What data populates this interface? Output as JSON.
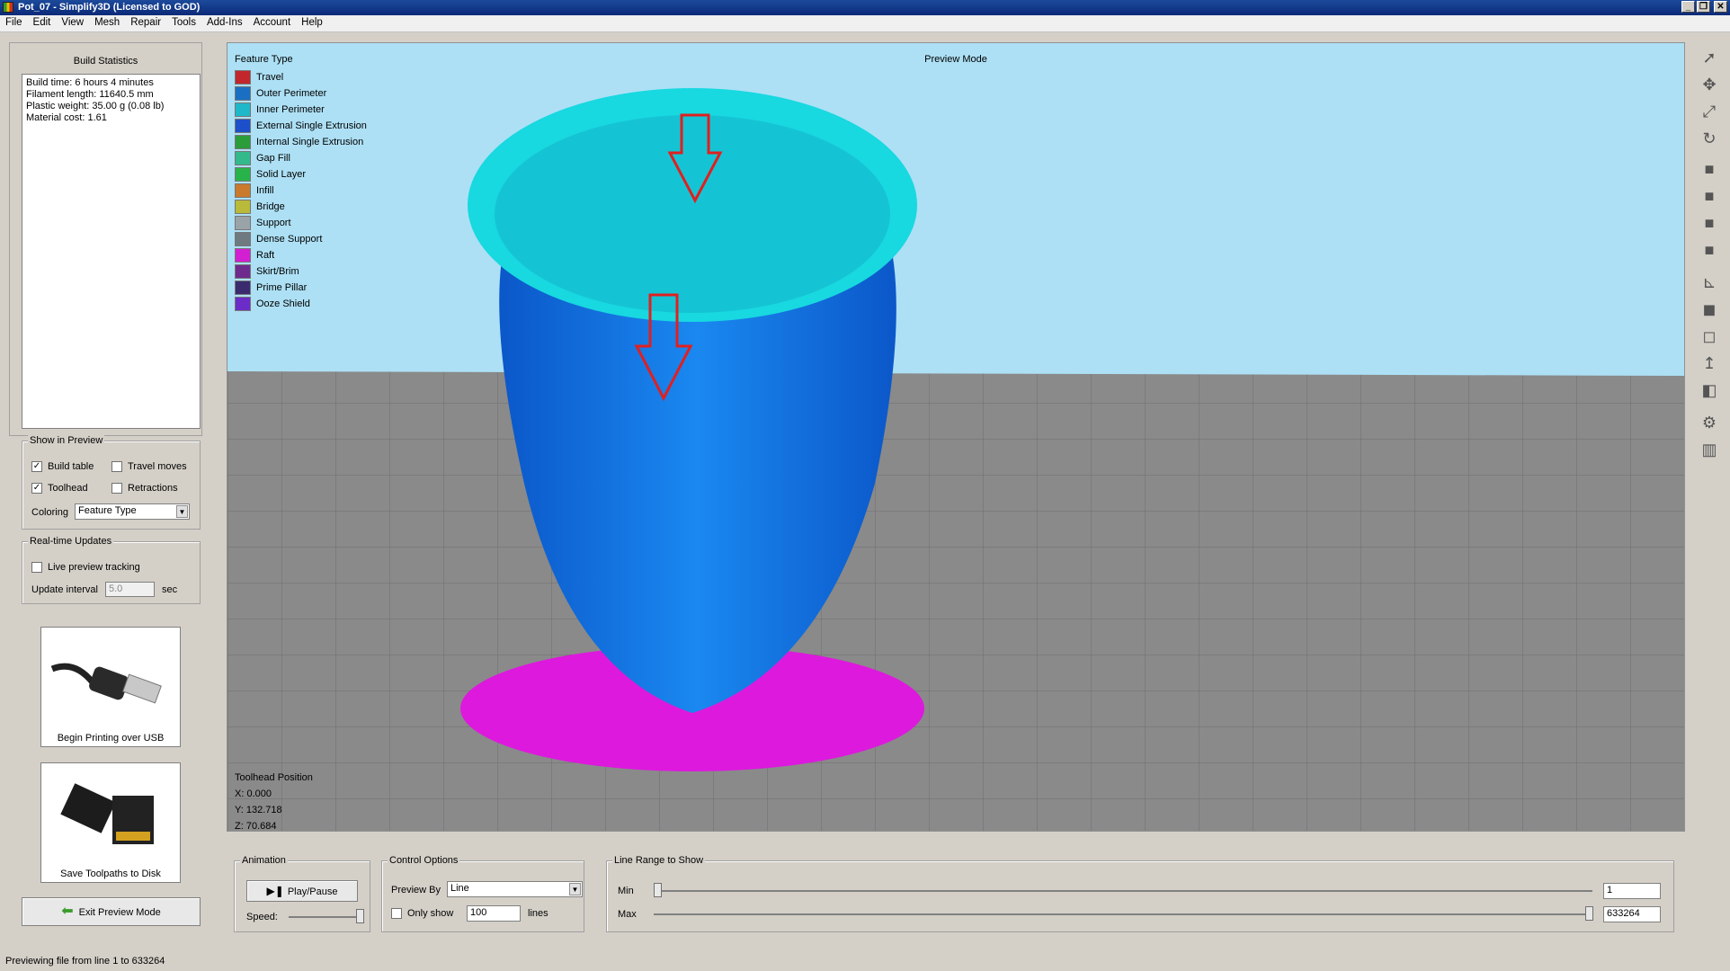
{
  "window": {
    "title": "Pot_07 - Simplify3D (Licensed to GOD)"
  },
  "menu": [
    "File",
    "Edit",
    "View",
    "Mesh",
    "Repair",
    "Tools",
    "Add-Ins",
    "Account",
    "Help"
  ],
  "build_stats": {
    "title": "Build Statistics",
    "lines": [
      "Build time: 6 hours 4 minutes",
      "Filament length: 11640.5 mm",
      "Plastic weight: 35.00 g (0.08 lb)",
      "Material cost: 1.61"
    ]
  },
  "show_in_preview": {
    "title": "Show in Preview",
    "build_table": {
      "label": "Build table",
      "checked": true
    },
    "travel_moves": {
      "label": "Travel moves",
      "checked": false
    },
    "toolhead": {
      "label": "Toolhead",
      "checked": true
    },
    "retractions": {
      "label": "Retractions",
      "checked": false
    },
    "coloring_label": "Coloring",
    "coloring_value": "Feature Type"
  },
  "realtime": {
    "title": "Real-time Updates",
    "live_label": "Live preview tracking",
    "interval_label": "Update interval",
    "interval_value": "5.0",
    "interval_unit": "sec"
  },
  "usb_button": {
    "label": "Begin Printing over USB"
  },
  "sd_button": {
    "label": "Save Toolpaths to Disk"
  },
  "exit_button": {
    "label": "Exit Preview Mode"
  },
  "viewport": {
    "mode_label": "Preview Mode",
    "legend_title": "Feature Type",
    "legend": [
      {
        "label": "Travel",
        "color": "#c1272d"
      },
      {
        "label": "Outer Perimeter",
        "color": "#1b6fc2"
      },
      {
        "label": "Inner Perimeter",
        "color": "#1fb8c9"
      },
      {
        "label": "External Single Extrusion",
        "color": "#1c4fc9"
      },
      {
        "label": "Internal Single Extrusion",
        "color": "#2a9c3a"
      },
      {
        "label": "Gap Fill",
        "color": "#33b98b"
      },
      {
        "label": "Solid Layer",
        "color": "#28b34a"
      },
      {
        "label": "Infill",
        "color": "#c97a2c"
      },
      {
        "label": "Bridge",
        "color": "#b9b93a"
      },
      {
        "label": "Support",
        "color": "#9aa3a8"
      },
      {
        "label": "Dense Support",
        "color": "#6f7a80"
      },
      {
        "label": "Raft",
        "color": "#d21fd2"
      },
      {
        "label": "Skirt/Brim",
        "color": "#6e2a8c"
      },
      {
        "label": "Prime Pillar",
        "color": "#3a2a6e"
      },
      {
        "label": "Ooze Shield",
        "color": "#6b2cc7"
      }
    ],
    "toolhead_title": "Toolhead Position",
    "x": "X: 0.000",
    "y": "Y: 132.718",
    "z": "Z: 70.684"
  },
  "animation": {
    "title": "Animation",
    "play_label": "Play/Pause",
    "speed_label": "Speed:"
  },
  "control_options": {
    "title": "Control Options",
    "preview_by_label": "Preview By",
    "preview_by_value": "Line",
    "only_show_label": "Only show",
    "only_show_value": "100",
    "lines_label": "lines"
  },
  "line_range": {
    "title": "Line Range to Show",
    "min_label": "Min",
    "max_label": "Max",
    "min_value": "1",
    "max_value": "633264"
  },
  "status": "Previewing file from line 1 to 633264"
}
